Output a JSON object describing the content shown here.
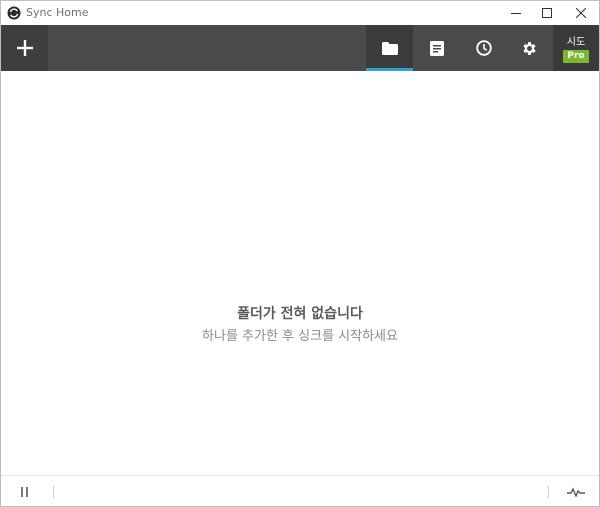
{
  "window": {
    "title": "Sync Home"
  },
  "toolbar": {
    "add_icon": "plus-icon",
    "tabs": [
      {
        "icon": "folder-icon",
        "active": true
      },
      {
        "icon": "document-list-icon",
        "active": false
      },
      {
        "icon": "clock-icon",
        "active": false
      },
      {
        "icon": "gear-icon",
        "active": false
      }
    ],
    "trial_label": "시도",
    "pro_badge": "Pro"
  },
  "main": {
    "empty_title": "폴더가 전혀 없습니다",
    "empty_subtitle": "하나를 추가한 후 싱크를 시작하세요"
  },
  "statusbar": {
    "pause_icon": "pause-icon",
    "activity_icon": "activity-pulse-icon"
  },
  "colors": {
    "toolbar_bg": "#4a4a4a",
    "active_tab_underline": "#2d9fd9",
    "pro_badge_bg": "#7cb82f"
  }
}
